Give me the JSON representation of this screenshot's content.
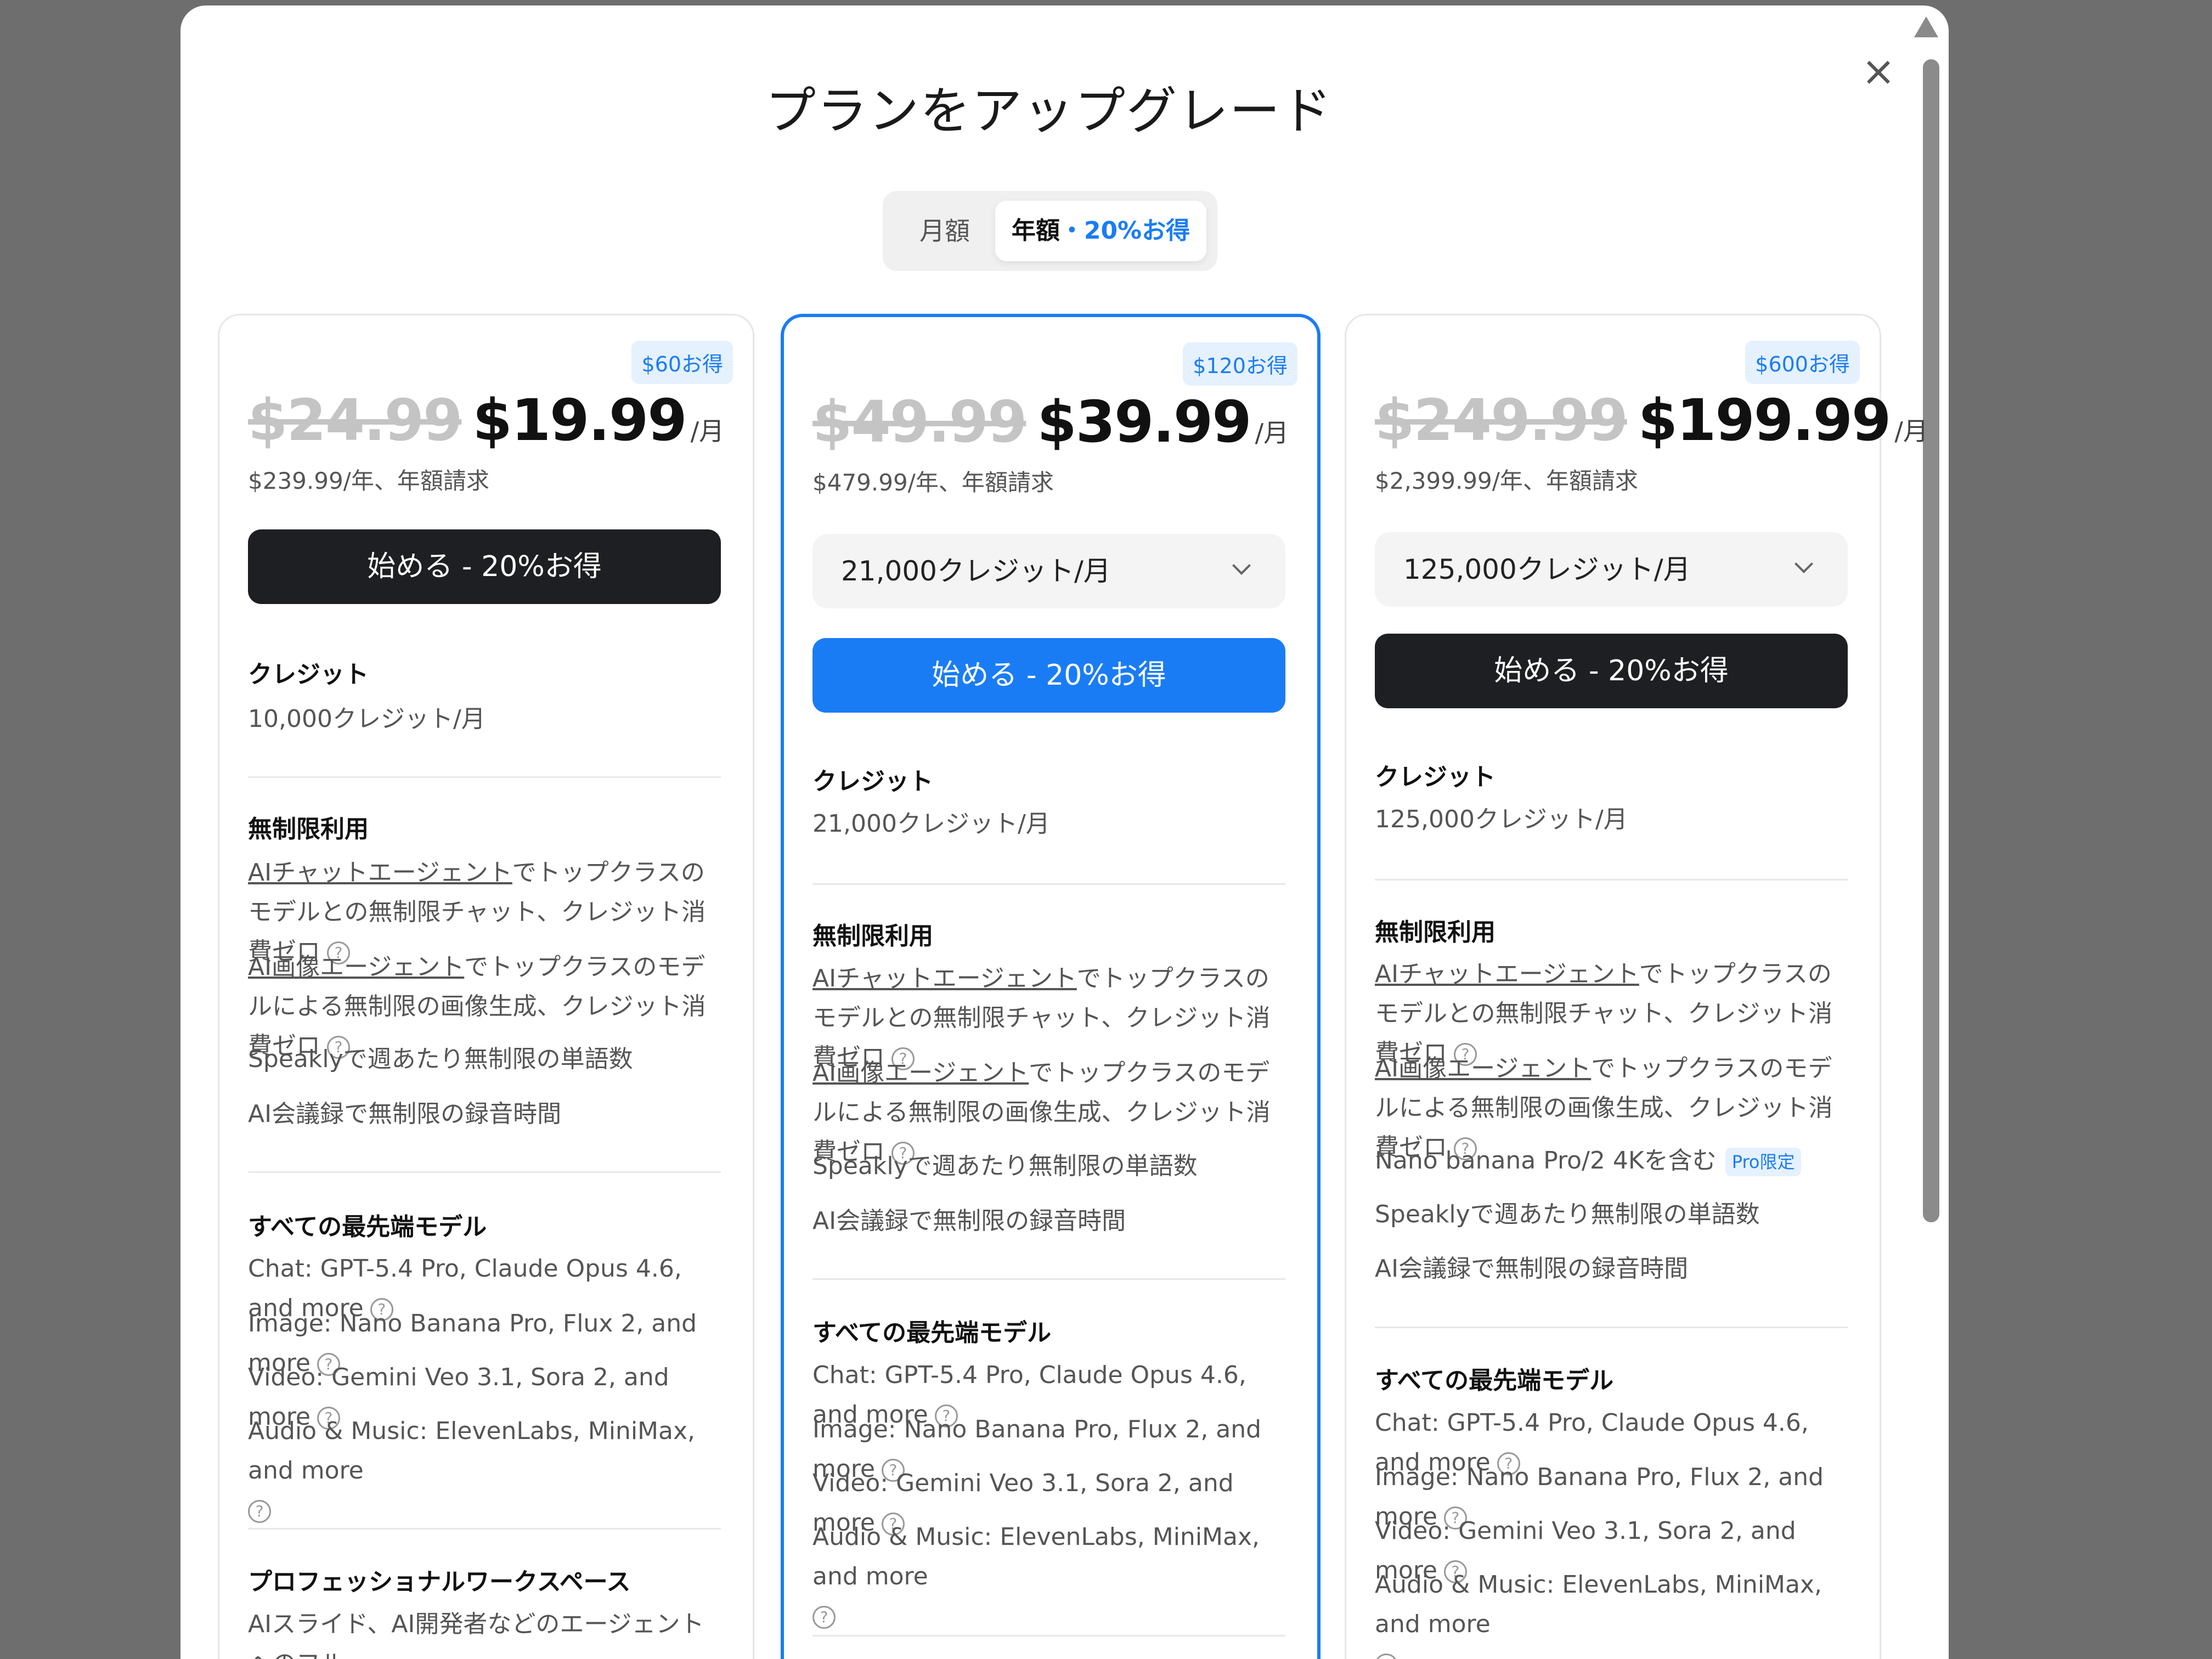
{
  "title": "プランをアップグレード",
  "close_label": "×",
  "billing_toggle": {
    "monthly": "月額",
    "yearly": "年額",
    "separator": "・",
    "discount": "20%お得"
  },
  "colors": {
    "accent": "#1a7cf5",
    "dark_button": "#1e1f22",
    "badge_bg": "#e5f1ff"
  },
  "plans": [
    {
      "badge": "$60お得",
      "old_price": "$24.99",
      "new_price": "$19.99",
      "per": "/月",
      "billing": "$239.99/年、年額請求",
      "cta": "始める - 20%お得",
      "credits_title": "クレジット",
      "credits": "10,000クレジット/月",
      "unlimited_title": "無制限利用",
      "unlimited": {
        "chat_link": "AIチャットエージェント",
        "chat_text": "でトップクラスのモデルとの無制限チャット、クレジット消費ゼロ",
        "image_link": "AI画像エージェント",
        "image_text": "でトップクラスのモデルによる無制限の画像生成、クレジット消費ゼロ",
        "speakly": "Speaklyで週あたり無制限の単語数",
        "meeting": "AI会議録で無制限の録音時間"
      },
      "models_title": "すべての最先端モデル",
      "models": {
        "chat": "Chat: GPT-5.4 Pro, Claude Opus 4.6, and more",
        "image": "Image: Nano Banana Pro, Flux 2, and more",
        "video": "Video: Gemini Veo 3.1, Sora 2, and more",
        "audio": "Audio & Music: ElevenLabs, MiniMax, and more"
      },
      "workspace_title": "プロフェッショナルワークスペース",
      "workspace_line": "AIスライド、AI開発者などのエージェントへのフル"
    },
    {
      "badge": "$120お得",
      "old_price": "$49.99",
      "new_price": "$39.99",
      "per": "/月",
      "billing": "$479.99/年、年額請求",
      "dropdown": "21,000クレジット/月",
      "cta": "始める - 20%お得",
      "credits_title": "クレジット",
      "credits": "21,000クレジット/月",
      "unlimited_title": "無制限利用",
      "unlimited": {
        "chat_link": "AIチャットエージェント",
        "chat_text": "でトップクラスのモデルとの無制限チャット、クレジット消費ゼロ",
        "image_link": "AI画像エージェント",
        "image_text": "でトップクラスのモデルによる無制限の画像生成、クレジット消費ゼロ",
        "speakly": "Speaklyで週あたり無制限の単語数",
        "meeting": "AI会議録で無制限の録音時間"
      },
      "models_title": "すべての最先端モデル",
      "models": {
        "chat": "Chat: GPT-5.4 Pro, Claude Opus 4.6, and more",
        "image": "Image: Nano Banana Pro, Flux 2, and more",
        "video": "Video: Gemini Veo 3.1, Sora 2, and more",
        "audio": "Audio & Music: ElevenLabs, MiniMax, and more"
      }
    },
    {
      "badge": "$600お得",
      "old_price": "$249.99",
      "new_price": "$199.99",
      "per": "/月",
      "billing": "$2,399.99/年、年額請求",
      "dropdown": "125,000クレジット/月",
      "cta": "始める - 20%お得",
      "credits_title": "クレジット",
      "credits": "125,000クレジット/月",
      "unlimited_title": "無制限利用",
      "unlimited": {
        "chat_link": "AIチャットエージェント",
        "chat_text": "でトップクラスのモデルとの無制限チャット、クレジット消費ゼロ",
        "image_link": "AI画像エージェント",
        "image_text": "でトップクラスのモデルによる無制限の画像生成、クレジット消費ゼロ",
        "nano": "Nano banana Pro/2 4Kを含む",
        "nano_badge": "Pro限定",
        "speakly": "Speaklyで週あたり無制限の単語数",
        "meeting": "AI会議録で無制限の録音時間"
      },
      "models_title": "すべての最先端モデル",
      "models": {
        "chat": "Chat: GPT-5.4 Pro, Claude Opus 4.6, and more",
        "image": "Image: Nano Banana Pro, Flux 2, and more",
        "video": "Video: Gemini Veo 3.1, Sora 2, and more",
        "audio": "Audio & Music: ElevenLabs, MiniMax, and more"
      }
    }
  ]
}
